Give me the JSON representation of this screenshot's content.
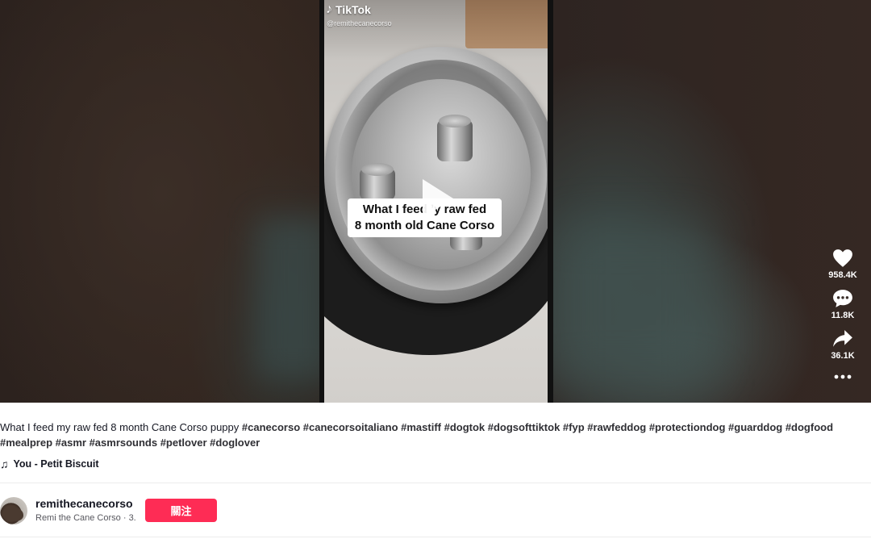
{
  "video": {
    "brand": "TikTok",
    "watermark_user": "@remithecanecorso",
    "caption_line1": "What I feed  ʼy raw fed",
    "caption_line2": "8 month old Cane Corso"
  },
  "actions": {
    "likes": "958.4K",
    "comments": "11.8K",
    "shares": "36.1K"
  },
  "description": {
    "text": "What I feed my raw fed 8 month Cane Corso puppy ",
    "hashtags": "#canecorso #canecorsoitaliano #mastiff #dogtok #dogsofttiktok #fyp #rawfeddog #protectiondog #guarddog #dogfood #mealprep #asmr #asmrsounds #petlover #doglover"
  },
  "music": {
    "icon": "♫",
    "title": "You - Petit Biscuit"
  },
  "creator": {
    "username": "remithecanecorso",
    "display_name": "Remi the Cane Corso",
    "separator": " · ",
    "date": "3.",
    "follow_label": "關注"
  },
  "colors": {
    "follow": "#fe2c55",
    "text": "#161823"
  },
  "icons": [
    "heart-icon",
    "comment-icon",
    "share-icon",
    "more-icon",
    "music-note-icon",
    "play-icon"
  ]
}
